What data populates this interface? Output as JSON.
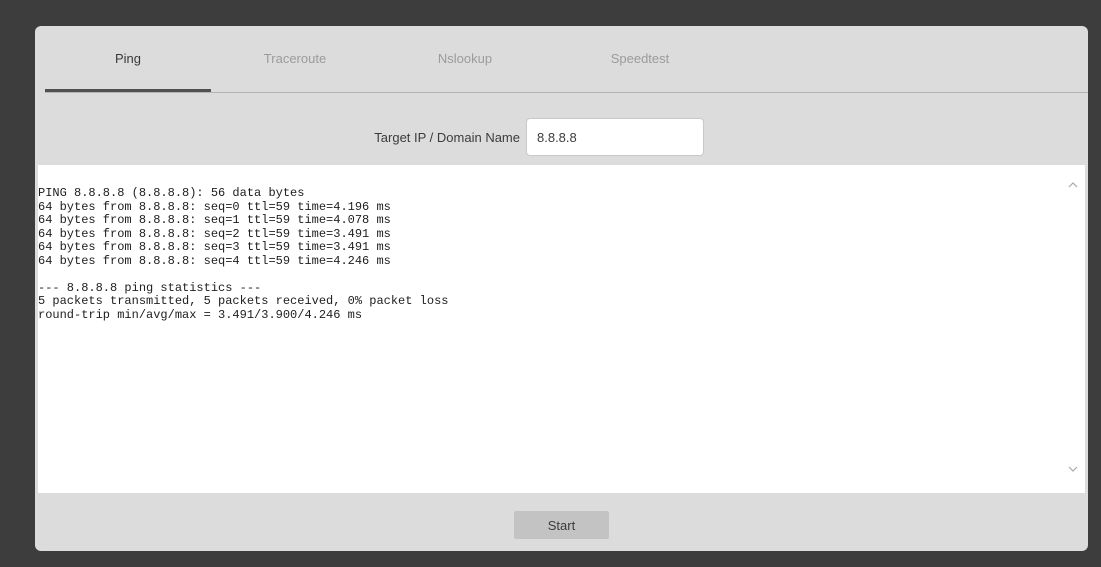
{
  "tabs": [
    {
      "label": "Ping",
      "active": true
    },
    {
      "label": "Traceroute",
      "active": false
    },
    {
      "label": "Nslookup",
      "active": false
    },
    {
      "label": "Speedtest",
      "active": false
    }
  ],
  "target": {
    "label": "Target IP / Domain Name",
    "value": "8.8.8.8"
  },
  "output": {
    "lines": "PING 8.8.8.8 (8.8.8.8): 56 data bytes\n64 bytes from 8.8.8.8: seq=0 ttl=59 time=4.196 ms\n64 bytes from 8.8.8.8: seq=1 ttl=59 time=4.078 ms\n64 bytes from 8.8.8.8: seq=2 ttl=59 time=3.491 ms\n64 bytes from 8.8.8.8: seq=3 ttl=59 time=3.491 ms\n64 bytes from 8.8.8.8: seq=4 ttl=59 time=4.246 ms\n\n--- 8.8.8.8 ping statistics ---\n5 packets transmitted, 5 packets received, 0% packet loss\nround-trip min/avg/max = 3.491/3.900/4.246 ms",
    "scroll_up_icon": "^",
    "scroll_down_icon": "v"
  },
  "actions": {
    "start_label": "Start"
  }
}
